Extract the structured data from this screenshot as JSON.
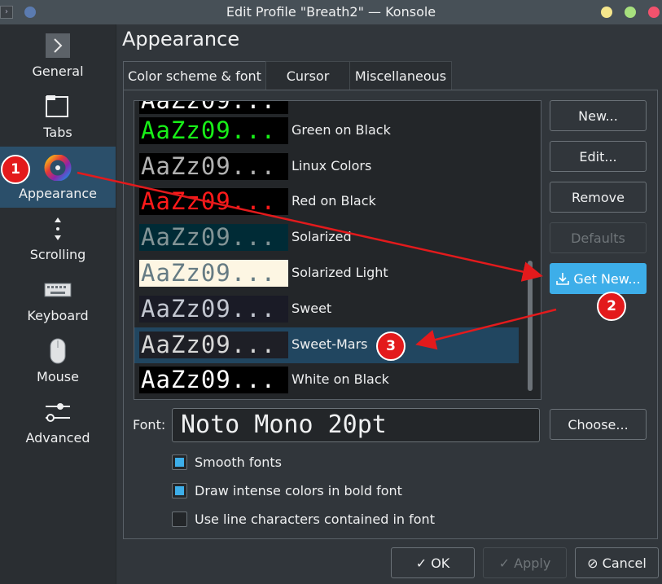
{
  "window": {
    "title": "Edit Profile \"Breath2\" — Konsole",
    "controls": [
      "minimize",
      "maximize",
      "close"
    ]
  },
  "sidebar": {
    "items": [
      {
        "label": "General",
        "icon": "general-icon"
      },
      {
        "label": "Tabs",
        "icon": "tabs-icon"
      },
      {
        "label": "Appearance",
        "icon": "color-wheel-icon",
        "selected": true
      },
      {
        "label": "Scrolling",
        "icon": "scroll-icon"
      },
      {
        "label": "Keyboard",
        "icon": "keyboard-icon"
      },
      {
        "label": "Mouse",
        "icon": "mouse-icon"
      },
      {
        "label": "Advanced",
        "icon": "sliders-icon"
      }
    ]
  },
  "page": {
    "heading": "Appearance"
  },
  "tabs": [
    {
      "label": "Color scheme & font",
      "active": true
    },
    {
      "label": "Cursor"
    },
    {
      "label": "Miscellaneous"
    }
  ],
  "schemes": {
    "sample_text": "AaZz09...",
    "items": [
      {
        "name": "",
        "fg": "#ffffff",
        "bg": "#000000"
      },
      {
        "name": "Green on Black",
        "fg": "#18f018",
        "bg": "#000000"
      },
      {
        "name": "Linux Colors",
        "fg": "#b2b2b2",
        "bg": "#000000"
      },
      {
        "name": "Red on Black",
        "fg": "#ff1a1a",
        "bg": "#000000"
      },
      {
        "name": "Solarized",
        "fg": "#839496",
        "bg": "#002b36"
      },
      {
        "name": "Solarized Light",
        "fg": "#657b83",
        "bg": "#fdf6e3"
      },
      {
        "name": "Sweet",
        "fg": "#c3c7d1",
        "bg": "#1a1b26"
      },
      {
        "name": "Sweet-Mars",
        "fg": "#d8d8d8",
        "bg": "#1e1f26",
        "selected": true
      },
      {
        "name": "White on Black",
        "fg": "#ffffff",
        "bg": "#000000"
      }
    ]
  },
  "buttons": {
    "new": "New...",
    "edit": "Edit...",
    "remove": "Remove",
    "defaults": "Defaults",
    "get_new": "Get New...",
    "choose": "Choose..."
  },
  "font": {
    "label": "Font:",
    "value": "Noto Mono 20pt"
  },
  "options": [
    {
      "label": "Smooth fonts",
      "checked": true
    },
    {
      "label": "Draw intense colors in bold font",
      "checked": true
    },
    {
      "label": "Use line characters contained in font",
      "checked": false
    }
  ],
  "footer": {
    "ok": "OK",
    "apply": "Apply",
    "cancel": "Cancel"
  },
  "annotations": {
    "badges": [
      "1",
      "2",
      "3"
    ],
    "color": "#e31a1c"
  },
  "colors": {
    "accent": "#3daee9",
    "selection": "#214660",
    "sidebar_selection": "#2b4f6a"
  }
}
